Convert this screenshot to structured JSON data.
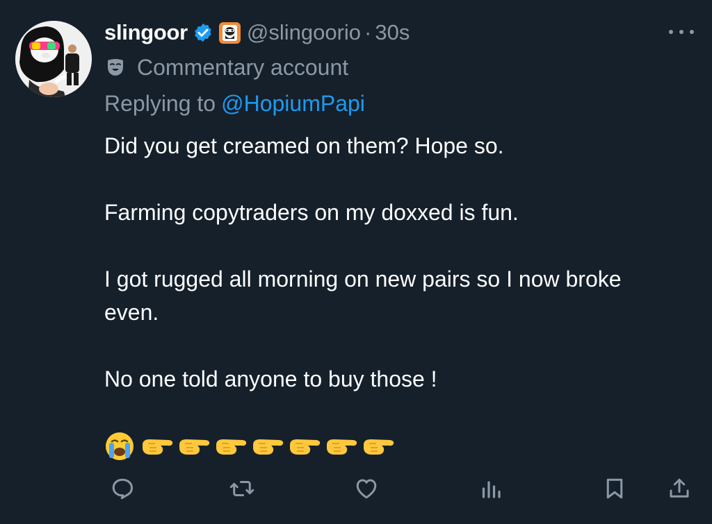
{
  "tweet": {
    "author_name": "slingoor",
    "handle": "@slingoorio",
    "separator": "·",
    "time": "30s",
    "label": "Commentary account",
    "replying_prefix": "Replying to",
    "replying_to": "@HopiumPapi",
    "paragraphs": [
      "Did you get creamed on them? Hope so.",
      "Farming copytraders on my doxxed is fun.",
      "I got rugged all morning on new pairs so I now broke even.",
      "No one told anyone to buy those !"
    ],
    "emojis": [
      "crying-face",
      "backhand-index-pointing-right",
      "backhand-index-pointing-right",
      "backhand-index-pointing-right",
      "backhand-index-pointing-right",
      "backhand-index-pointing-right",
      "backhand-index-pointing-right",
      "backhand-index-pointing-right"
    ]
  },
  "actions": [
    "reply-icon",
    "retweet-icon",
    "like-icon",
    "views-icon",
    "bookmark-icon",
    "share-icon"
  ],
  "colors": {
    "background": "#15202b",
    "text": "#ffffff",
    "muted": "#8b98a5",
    "link": "#1d9bf0",
    "verified": "#1d9bf0",
    "affiliate_badge": "#f28c38"
  }
}
